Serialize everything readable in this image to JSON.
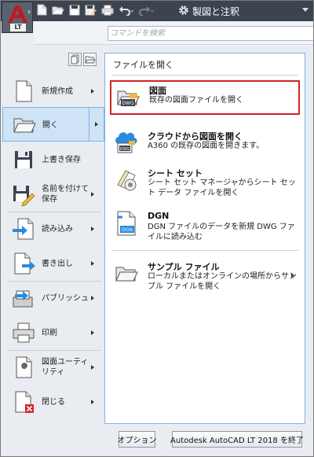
{
  "app": {
    "logo_badge": "LT",
    "brand_color": "#c4161c"
  },
  "quick_access": {
    "icons": [
      "new-icon",
      "open-icon",
      "save-icon",
      "save-as-icon",
      "print-icon",
      "undo-icon",
      "redo-icon"
    ],
    "workspace_label": "製図と注釈"
  },
  "search": {
    "placeholder": "コマンドを検索"
  },
  "left_menu": {
    "items": [
      {
        "label": "新規作成",
        "icon": "new-doc-icon",
        "has_arrow": true
      },
      {
        "label": "開く",
        "icon": "open-folder-icon",
        "has_arrow": true,
        "active": true
      },
      {
        "label": "上書き保存",
        "icon": "save-icon",
        "has_arrow": false
      },
      {
        "label": "名前を付けて保存",
        "icon": "save-as-icon",
        "has_arrow": true
      },
      {
        "label": "読み込み",
        "icon": "import-icon",
        "has_arrow": true
      },
      {
        "label": "書き出し",
        "icon": "export-icon",
        "has_arrow": true
      },
      {
        "label": "パブリッシュ",
        "icon": "publish-icon",
        "has_arrow": true
      },
      {
        "label": "印刷",
        "icon": "print-icon",
        "has_arrow": true
      },
      {
        "label": "図面ユーティリティ",
        "icon": "wrench-icon",
        "has_arrow": true
      },
      {
        "label": "閉じる",
        "icon": "close-doc-icon",
        "has_arrow": true
      }
    ]
  },
  "right_pane": {
    "title": "ファイルを開く",
    "entries": [
      {
        "title": "図面",
        "desc": "既存の図面ファイルを開く",
        "icon": "dwg-file-icon",
        "highlight": true
      },
      {
        "title": "クラウドから図面を開く",
        "desc": "A360 の既存の図面を開きます。",
        "icon": "cloud-dwg-icon"
      },
      {
        "title": "シート セット",
        "desc": "シート セット マネージャからシート セット データ ファイルを開く",
        "icon": "sheet-set-icon"
      },
      {
        "title": "DGN",
        "desc": "DGN ファイルのデータを新規 DWG ファイルに読み込む",
        "icon": "dgn-file-icon"
      },
      {
        "title": "サンプル ファイル",
        "desc": "ローカルまたはオンラインの場所からサンプル ファイルを開く",
        "icon": "sample-folder-icon",
        "has_arrow": true
      }
    ]
  },
  "bottom": {
    "options_label": "オプション",
    "exit_label": "Autodesk AutoCAD LT 2018 を終了"
  }
}
